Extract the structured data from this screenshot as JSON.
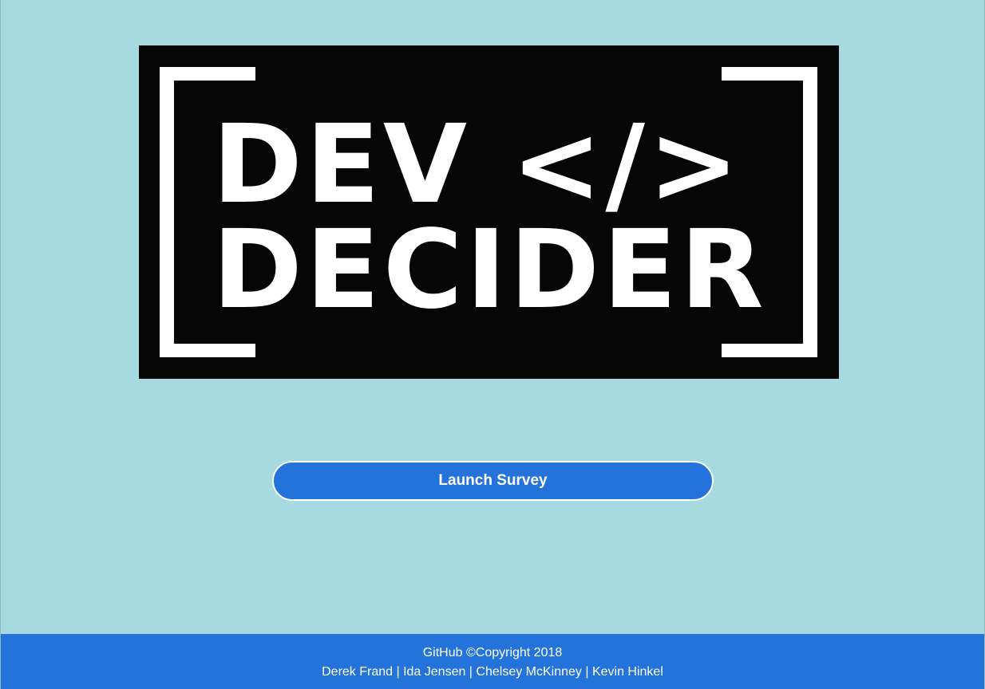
{
  "logo": {
    "line1": "DEV </>",
    "line2": "DECIDER"
  },
  "main": {
    "launch_button_label": "Launch Survey"
  },
  "footer": {
    "github_link": "GitHub",
    "copyright": "©Copyright 2018",
    "authors": "Derek Frand | Ida Jensen | Chelsey McKinney | Kevin Hinkel"
  },
  "colors": {
    "background": "#a6dae0",
    "logo_background": "#060606",
    "accent": "#2473db",
    "text_on_accent": "#ffffff"
  }
}
